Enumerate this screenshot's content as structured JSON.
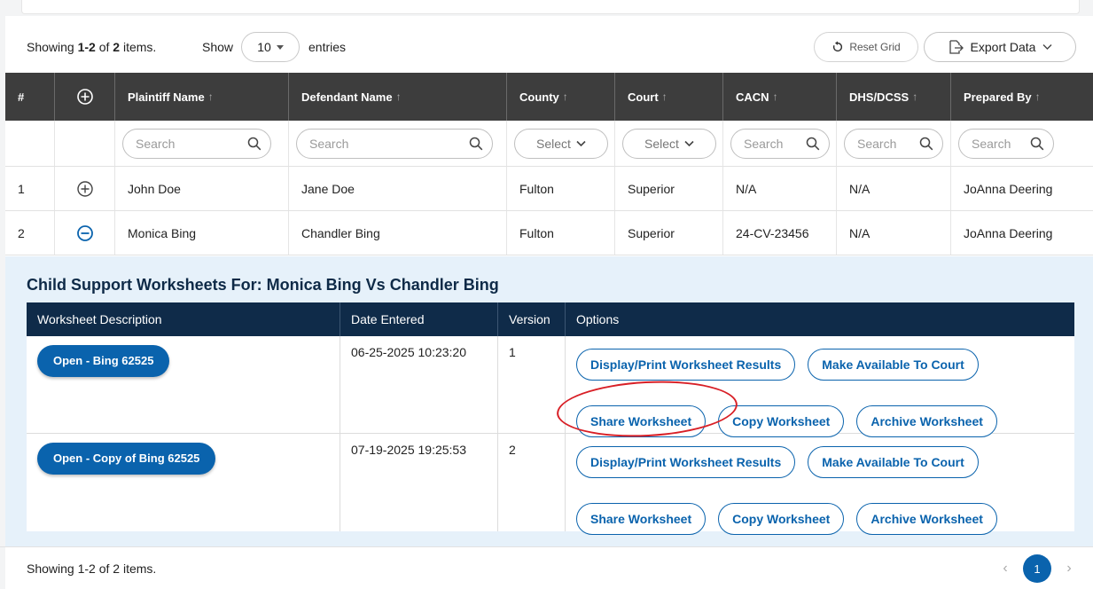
{
  "toolbar": {
    "showing_prefix": "Showing ",
    "showing_range": "1-2",
    "showing_mid": " of ",
    "showing_total": "2",
    "showing_suffix": " items.",
    "show_label": "Show",
    "entries_value": "10",
    "entries_label": "entries",
    "reset_label": "Reset Grid",
    "export_label": "Export Data"
  },
  "grid": {
    "columns": [
      "#",
      "",
      "Plaintiff Name",
      "Defendant Name",
      "County",
      "Court",
      "CACN",
      "DHS/DCSS",
      "Prepared By"
    ],
    "sort_arrow": "↑",
    "filters": {
      "search_placeholder": "Search",
      "select_placeholder": "Select"
    },
    "rows": [
      {
        "num": "1",
        "plaintiff": "John Doe",
        "defendant": "Jane Doe",
        "county": "Fulton",
        "court": "Superior",
        "cacn": "N/A",
        "dhs": "N/A",
        "prepared_by": "JoAnna Deering",
        "expanded": false
      },
      {
        "num": "2",
        "plaintiff": "Monica Bing",
        "defendant": "Chandler Bing",
        "county": "Fulton",
        "court": "Superior",
        "cacn": "24-CV-23456",
        "dhs": "N/A",
        "prepared_by": "JoAnna Deering",
        "expanded": true
      }
    ]
  },
  "detail": {
    "title": "Child Support Worksheets For: Monica Bing Vs Chandler Bing",
    "columns": [
      "Worksheet Description",
      "Date Entered",
      "Version",
      "Options"
    ],
    "worksheets": [
      {
        "open_label": "Open - Bing 62525",
        "date": "06-25-2025 10:23:20",
        "version": "1"
      },
      {
        "open_label": "Open - Copy of Bing 62525",
        "date": "07-19-2025 19:25:53",
        "version": "2"
      }
    ],
    "options": {
      "display_print": "Display/Print Worksheet Results",
      "make_available": "Make Available To Court",
      "share": "Share Worksheet",
      "copy": "Copy Worksheet",
      "archive": "Archive Worksheet"
    }
  },
  "footer": {
    "text": "Showing 1-2 of 2 items.",
    "current_page": "1"
  },
  "colors": {
    "header_dark": "#3d3d3d",
    "worksheet_header": "#0f2b49",
    "primary_blue": "#0a63ad",
    "panel_bg": "#e6f1fa",
    "annotation_red": "#d81f26"
  }
}
